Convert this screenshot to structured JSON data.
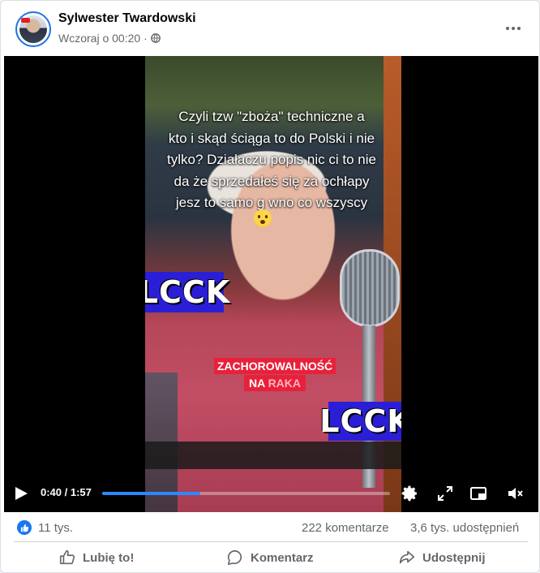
{
  "post": {
    "author": "Sylwester Twardowski",
    "timestamp": "Wczoraj o 00:20",
    "separator": "·",
    "more_icon": "more-dots-icon"
  },
  "video": {
    "overlay_lines": [
      "Czyli tzw \"zboża\" techniczne a",
      "kto i skąd ściąga to do Polski i nie",
      "tylko? Działaczu popis nic ci to nie",
      "da że sprzedałeś się za ochłapy",
      "jesz to samo g    wno co wszyscy"
    ],
    "sticker_1": "LCCK",
    "sticker_2": "LCCK",
    "banner_line1": "ZACHOROWALNOŚĆ",
    "banner_line2_a": "NA ",
    "banner_line2_b": "RAKA",
    "time_display": "0:40 / 1:57",
    "progress_fraction": 0.34,
    "accent_color": "#2d88ff"
  },
  "stats": {
    "likes": "11 tys.",
    "comments": "222 komentarze",
    "shares": "3,6 tys. udostępnień"
  },
  "actions": {
    "like": "Lubię to!",
    "comment": "Komentarz",
    "share": "Udostępnij"
  }
}
